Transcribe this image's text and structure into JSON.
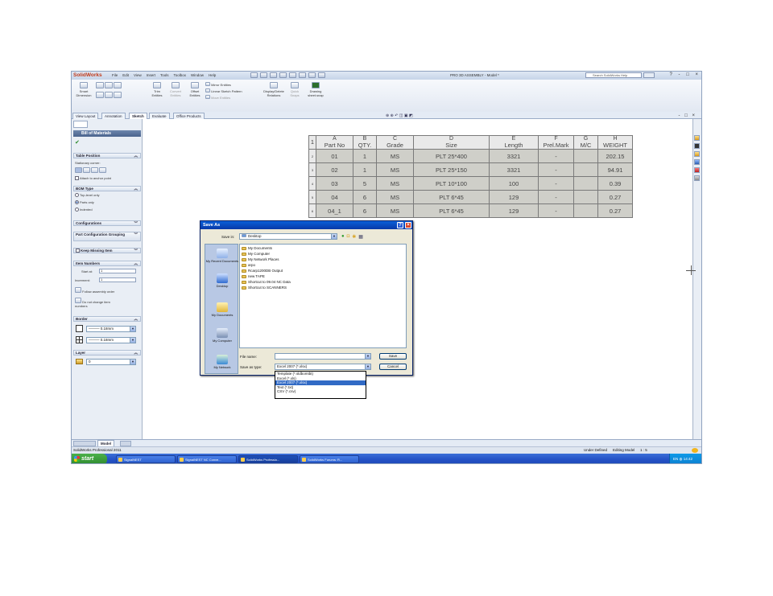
{
  "app": {
    "logo": "SolidWorks",
    "menu": [
      "File",
      "Edit",
      "View",
      "Insert",
      "Tools",
      "Toolbox",
      "Window",
      "Help"
    ],
    "title": "PRO 3D ASSEMBLY - Model *",
    "search_placeholder": "Search SolidWorks Help",
    "window_controls": "? - □ ×"
  },
  "command_manager": {
    "smart_dimension": "Smart Dimension",
    "trim": "Trim Entities",
    "convert": "Convert Entities",
    "offset": "Offset Entities",
    "mirror": "Mirror Entities",
    "linear_pattern": "Linear Sketch Pattern",
    "move": "Move Entities",
    "display_delete": "Display/Delete Relations",
    "quick_snaps": "Quick Snaps",
    "drawing": "Drawing sheet.snap"
  },
  "tabs": [
    "View Layout",
    "Annotation",
    "Sketch",
    "Evaluate",
    "Office Products"
  ],
  "active_tab": "Sketch",
  "property_manager": {
    "title": "Bill of Materials",
    "table_position": "Table Position",
    "stationary_corner": "Stationary corner:",
    "attach_anchor": "Attach to anchor point",
    "bom_type": "BOM Type",
    "top_level": "Top-level only",
    "parts_only": "Parts only",
    "indented": "Indented",
    "configurations": "Configurations",
    "part_config_grouping": "Part Configuration Grouping",
    "keep_missing": "Keep Missing Item",
    "item_numbers": "Item Numbers",
    "start_at": "Start at:",
    "start_at_value": "1",
    "increment": "Increment:",
    "increment_value": "1",
    "follow_assembly": "Follow assembly order",
    "do_not_change": "Do not change item numbers",
    "border": "Border",
    "border_value1": "0.18mm",
    "border_value2": "0.18mm",
    "layer": "Layer",
    "layer_value": "0"
  },
  "bom": {
    "col_letters": [
      "A",
      "B",
      "C",
      "D",
      "E",
      "F",
      "G",
      "H"
    ],
    "headers": [
      "Part No",
      "QTY.",
      "Grade",
      "Size",
      "Length",
      "Prel.Mark",
      "M/C",
      "WEIGHT"
    ],
    "rows": [
      {
        "n": "2",
        "cells": [
          "01",
          "1",
          "MS",
          "PLT 25*400",
          "3321",
          "-",
          "",
          "202.15"
        ]
      },
      {
        "n": "3",
        "cells": [
          "02",
          "1",
          "MS",
          "PLT 25*150",
          "3321",
          "-",
          "",
          "94.91"
        ]
      },
      {
        "n": "4",
        "cells": [
          "03",
          "5",
          "MS",
          "PLT 10*100",
          "100",
          "-",
          "",
          "0.39"
        ]
      },
      {
        "n": "5",
        "cells": [
          "04",
          "6",
          "MS",
          "PLT 6*45",
          "129",
          "-",
          "",
          "0.27"
        ]
      },
      {
        "n": "6",
        "cells": [
          "04_1",
          "6",
          "MS",
          "PLT 6*45",
          "129",
          "-",
          "",
          "0.27"
        ]
      }
    ],
    "header_row_n": "1"
  },
  "dialog": {
    "title": "Save As",
    "save_in_label": "Save in:",
    "save_in_value": "Desktop",
    "places": [
      "My Recent Documents",
      "Desktop",
      "My Documents",
      "My Computer",
      "My Network"
    ],
    "files": [
      "My Documents",
      "My Computer",
      "My Network Places",
      "arpo",
      "Rcarp1200DB Output",
      "new TAPE",
      "Shortcut to 09.04 NC Data",
      "Shortcut to SCANNERS"
    ],
    "file_name_label": "File name:",
    "file_name_value": "",
    "save_as_type_label": "Save as type:",
    "save_as_type_value": "Excel 2007 (*.xlsx)",
    "save_button": "Save",
    "cancel_button": "Cancel",
    "help_btn": "?",
    "close_btn": "×",
    "type_options": [
      "Template (*.sldbomtbt)",
      "Excel (*.xls)",
      "Excel 2007 (*.xlsx)",
      "Text (*.txt)",
      "CSV (*.csv)"
    ],
    "type_selected_index": 2
  },
  "model_tabs": [
    "Model"
  ],
  "status": {
    "left": "SolidWorks Professional 2011",
    "state": "Under Defined",
    "editing": "Editing Model",
    "scale": "1 : 5"
  },
  "taskbar": {
    "start": "start",
    "items": [
      "SignalNEST",
      "SignalNEST NC Conve...",
      "SolidWorks Professio...",
      "SolidWorks Forums: R..."
    ],
    "lang": "EN",
    "clock": "14:42"
  }
}
